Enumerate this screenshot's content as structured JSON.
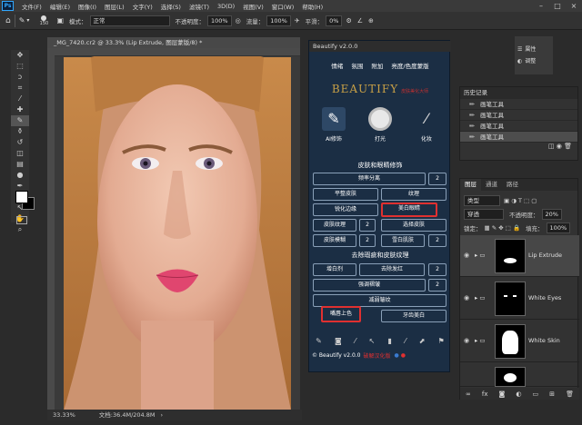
{
  "app": {
    "logo": "Ps",
    "menus": [
      "文件(F)",
      "编辑(E)",
      "图像(I)",
      "图层(L)",
      "文字(Y)",
      "选择(S)",
      "滤镜(T)",
      "3D(D)",
      "视图(V)",
      "窗口(W)",
      "帮助(H)"
    ]
  },
  "options": {
    "brush_size": "150",
    "mode_label": "模式：",
    "mode_value": "正常",
    "opacity_label": "不透明度：",
    "opacity_value": "100%",
    "flow_label": "流量：",
    "flow_value": "100%",
    "smooth_label": "平滑：",
    "smooth_value": "0%"
  },
  "document": {
    "tab_title": "_MG_7420.cr2 @ 33.3% (Lip Extrude, 图层蒙版/8) *",
    "zoom": "33.33%",
    "doc_size": "文档:36.4M/204.8M"
  },
  "beautify": {
    "title": "Beautify v2.0.0",
    "tabs": [
      "情绪",
      "氛围",
      "附加",
      "亮度/色度蒙版"
    ],
    "logo": "BEAUTIFY",
    "logo_sub": "皮肤美化大师",
    "categories": [
      "AI修饰",
      "打光",
      "化妆"
    ],
    "section1": "皮肤和眼睛修饰",
    "section2": "去除瑕疵和皮肤纹理",
    "buttons": {
      "freq_sep": "频率分离",
      "n1": "2",
      "flat_skin": "平整皮肤",
      "texture": "纹理",
      "sharpen_edge": "锐化边缘",
      "whiten_eyes": "美白眼睛",
      "skin_texture": "皮肤纹理",
      "n2": "2",
      "select_skin": "选择皮肤",
      "skin_blur": "皮肤模糊",
      "n3": "2",
      "snow_skin": "雪白肌肤",
      "n4": "2",
      "erase_pen": "增白剂",
      "remove_hair": "去除发红",
      "n5": "2",
      "strong_smooth": "强调褶皱",
      "n6": "2",
      "reduce_wrinkle": "减弱皱纹",
      "lip_color": "嘴唇上色",
      "teeth_white": "牙齿美白"
    },
    "footer": "© Beautify v2.0.0",
    "footer_red": "破解汉化版"
  },
  "mini_panel": {
    "properties": "属性",
    "adjust": "调整"
  },
  "history": {
    "tab": "历史记录",
    "rows": [
      "画笔工具",
      "画笔工具",
      "画笔工具",
      "画笔工具"
    ]
  },
  "layers": {
    "tabs": [
      "图层",
      "通道",
      "路径"
    ],
    "filter_label": "类型",
    "blend_mode": "穿透",
    "opacity_label": "不透明度：",
    "opacity_value": "20%",
    "lock_label": "锁定：",
    "fill_label": "填充：",
    "fill_value": "100%",
    "items": [
      "Lip Extrude",
      "White Eyes",
      "White Skin"
    ]
  }
}
